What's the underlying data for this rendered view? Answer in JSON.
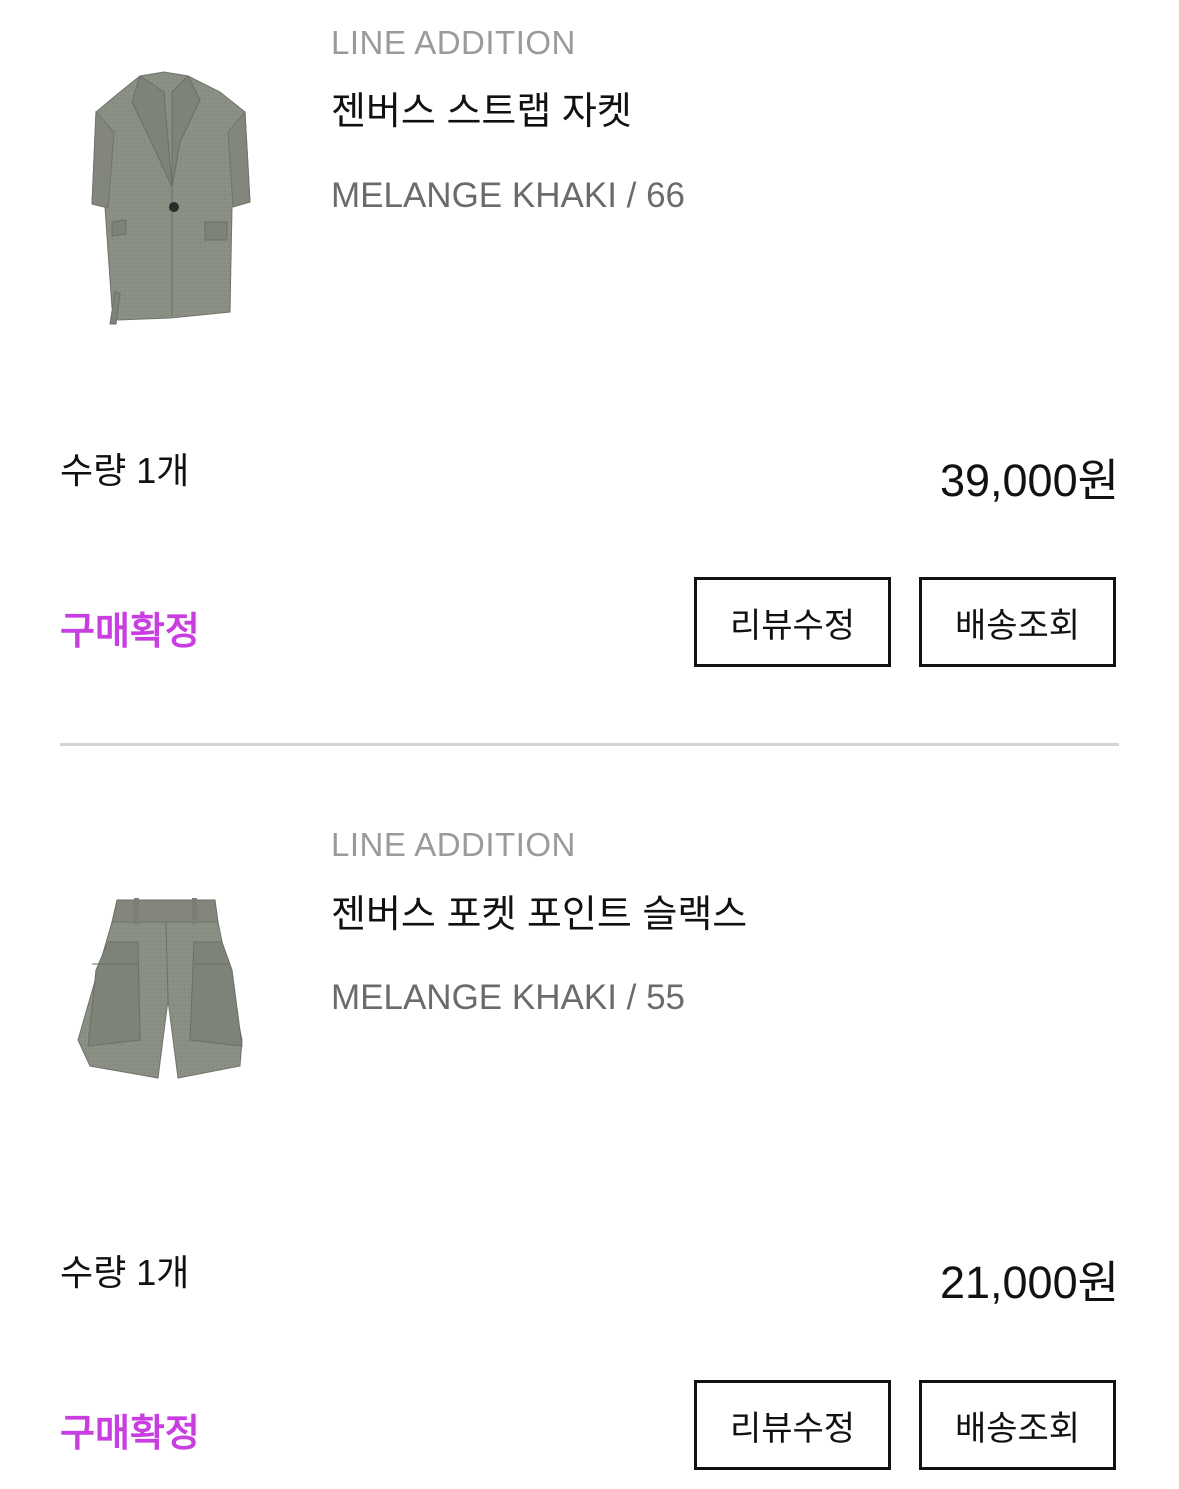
{
  "orders": [
    {
      "brand": "LINE ADDITION",
      "name": "젠버스 스트랩 자켓",
      "option": "MELANGE KHAKI / 66",
      "quantity": "수량 1개",
      "price": "39,000원",
      "status": "구매확정",
      "review_button": "리뷰수정",
      "tracking_button": "배송조회",
      "image": "jacket-image"
    },
    {
      "brand": "LINE ADDITION",
      "name": "젠버스 포켓 포인트 슬랙스",
      "option": "MELANGE KHAKI / 55",
      "quantity": "수량 1개",
      "price": "21,000원",
      "status": "구매확정",
      "review_button": "리뷰수정",
      "tracking_button": "배송조회",
      "image": "shorts-image"
    }
  ],
  "colors": {
    "status": "#c93ee0",
    "brand": "#9a9a9a",
    "option": "#6b6b6b",
    "divider": "#d4d4d4",
    "garment": "#8b9085"
  }
}
